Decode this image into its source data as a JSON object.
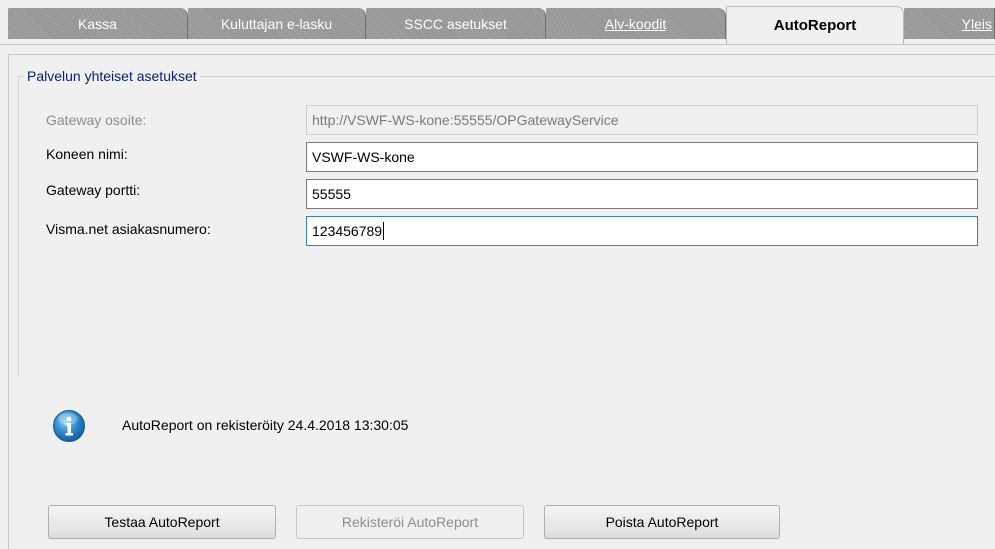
{
  "tabs": [
    {
      "label": "Kassa"
    },
    {
      "label": "Kuluttajan e-lasku"
    },
    {
      "label": "SSCC asetukset"
    },
    {
      "label": "Alv-koodit"
    },
    {
      "label": "AutoReport"
    },
    {
      "label": "Yleis"
    }
  ],
  "group": {
    "title": "Palvelun yhteiset asetukset"
  },
  "fields": {
    "gateway_address": {
      "label": "Gateway osoite:",
      "value": "http://VSWF-WS-kone:55555/OPGatewayService"
    },
    "machine_name": {
      "label": "Koneen nimi:",
      "value": "VSWF-WS-kone"
    },
    "gateway_port": {
      "label": "Gateway portti:",
      "value": "55555"
    },
    "customer_number": {
      "label": "Visma.net asiakasnumero:",
      "value": "123456789"
    }
  },
  "info": {
    "icon": "info-icon",
    "text": "AutoReport on rekisteröity 24.4.2018 13:30:05"
  },
  "buttons": {
    "test": "Testaa AutoReport",
    "register": "Rekisteröi AutoReport",
    "remove": "Poista AutoReport"
  }
}
